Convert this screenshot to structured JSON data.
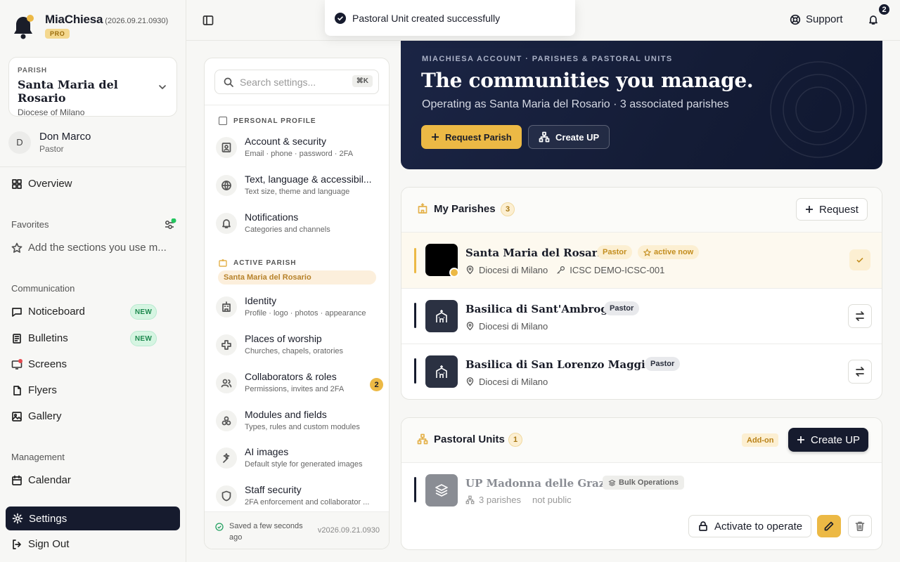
{
  "brand": {
    "name": "MiaChiesa",
    "version": "(2026.09.21.0930)",
    "plan_badge": "PRO"
  },
  "parish_selector": {
    "label": "PARISH",
    "name": "Santa Maria del Rosario",
    "diocese": "Diocese of Milano"
  },
  "user": {
    "initial": "D",
    "name": "Don Marco",
    "role": "Pastor"
  },
  "nav": {
    "overview": "Overview",
    "favorites_heading": "Favorites",
    "favorites_hint": "Add the sections you use m...",
    "communication_heading": "Communication",
    "noticeboard": "Noticeboard",
    "bulletins": "Bulletins",
    "screens": "Screens",
    "flyers": "Flyers",
    "gallery": "Gallery",
    "management_heading": "Management",
    "calendar": "Calendar",
    "settings": "Settings",
    "sign_out": "Sign Out",
    "new_badge": "NEW"
  },
  "topbar": {
    "support": "Support",
    "notifications_count": "2"
  },
  "toast": {
    "message": "Pastoral Unit created successfully"
  },
  "settings_panel": {
    "search_placeholder": "Search settings...",
    "search_shortcut": "⌘K",
    "personal_heading": "PERSONAL PROFILE",
    "active_parish_heading": "ACTIVE PARISH",
    "active_parish_name": "Santa Maria del Rosario",
    "items": [
      {
        "title": "Account & security",
        "sub": "Email · phone · password · 2FA"
      },
      {
        "title": "Text, language & accessibil...",
        "sub": "Text size, theme and language"
      },
      {
        "title": "Notifications",
        "sub": "Categories and channels"
      },
      {
        "title": "Identity",
        "sub": "Profile · logo · photos · appearance"
      },
      {
        "title": "Places of worship",
        "sub": "Churches, chapels, oratories"
      },
      {
        "title": "Collaborators & roles",
        "sub": "Permissions, invites and 2FA",
        "badge": "2"
      },
      {
        "title": "Modules and fields",
        "sub": "Types, rules and custom modules"
      },
      {
        "title": "AI images",
        "sub": "Default style for generated images"
      },
      {
        "title": "Staff security",
        "sub": "2FA enforcement and collaborator ..."
      }
    ],
    "saved_status": "Saved a few seconds ago",
    "footer_version": "v2026.09.21.0930"
  },
  "hero": {
    "eyebrow": "MIACHIESA ACCOUNT · PARISHES & PASTORAL UNITS",
    "title": "The communities you manage.",
    "subtitle": "Operating as Santa Maria del Rosario · 3 associated parishes",
    "request_button": "Request Parish",
    "create_button": "Create UP"
  },
  "my_parishes": {
    "title": "My Parishes",
    "count": "3",
    "request_button": "Request",
    "rows": [
      {
        "name": "Santa Maria del Rosario",
        "role": "Pastor",
        "status": "active now",
        "diocese": "Diocesi di Milano",
        "code": "ICSC DEMO-ICSC-001"
      },
      {
        "name": "Basilica di Sant'Ambrogio",
        "role": "Pastor",
        "diocese": "Diocesi di Milano"
      },
      {
        "name": "Basilica di San Lorenzo Maggiore",
        "role": "Pastor",
        "diocese": "Diocesi di Milano"
      }
    ]
  },
  "pastoral_units": {
    "title": "Pastoral Units",
    "count": "1",
    "addon_badge": "Add-on",
    "create_button": "Create UP",
    "rows": [
      {
        "name": "UP Madonna delle Grazie",
        "tag": "Bulk Operations",
        "parishes": "3 parishes",
        "visibility": "not public",
        "activate_button": "Activate to operate"
      }
    ]
  },
  "colors": {
    "accent_gold": "#ecb945",
    "navy": "#161b2e",
    "green_dot": "#22c55e",
    "red_dot": "#e5484d"
  }
}
